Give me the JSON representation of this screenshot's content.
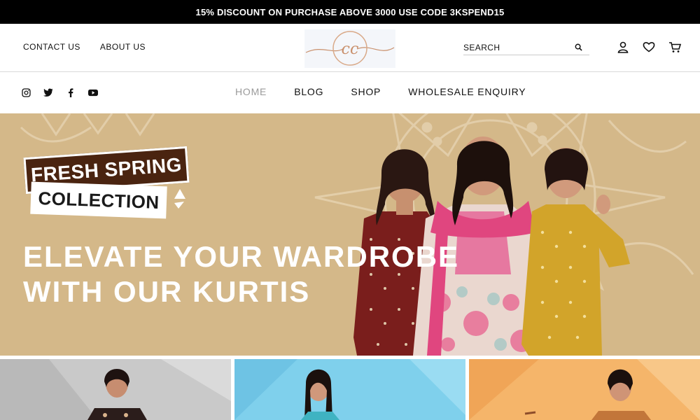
{
  "announcement": {
    "text": "15% DISCOUNT ON PURCHASE ABOVE 3000 USE CODE 3KSPEND15"
  },
  "header": {
    "contact_label": "CONTACT US",
    "about_label": "ABOUT US",
    "logo_text": "cc",
    "search_placeholder": "SEARCH"
  },
  "nav": {
    "items": [
      {
        "label": "HOME",
        "active": true
      },
      {
        "label": "BLOG",
        "active": false
      },
      {
        "label": "SHOP",
        "active": false
      },
      {
        "label": "WHOLESALE ENQUIRY",
        "active": false
      }
    ],
    "social_icons": [
      "instagram-icon",
      "twitter-icon",
      "facebook-icon",
      "youtube-icon"
    ]
  },
  "header_icons": [
    "user-icon",
    "heart-icon",
    "cart-icon"
  ],
  "hero": {
    "badge_top": "FRESH SPRING",
    "badge_bottom": "COLLECTION",
    "headline_line1": "ELEVATE YOUR WARDROBE",
    "headline_line2": "WITH OUR KURTIS"
  },
  "colors": {
    "announcement_bg": "#000000",
    "hero_bg": "#d4b889",
    "badge_brown": "#4a2410",
    "logo_rose_gold": "#c9906c",
    "card1_bg": "#c9c9c9",
    "card2_bg": "#7fd0ec",
    "card3_bg": "#f5b56a"
  }
}
